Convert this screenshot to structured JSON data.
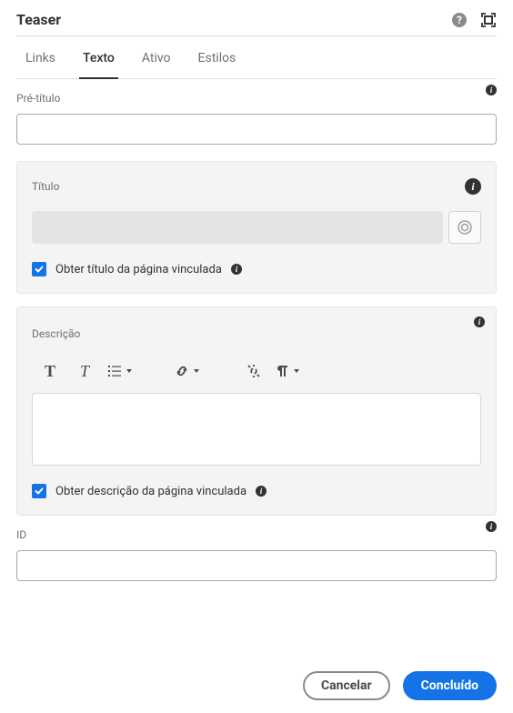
{
  "header": {
    "title": "Teaser"
  },
  "tabs": [
    {
      "label": "Links",
      "active": false
    },
    {
      "label": "Texto",
      "active": true
    },
    {
      "label": "Ativo",
      "active": false
    },
    {
      "label": "Estilos",
      "active": false
    }
  ],
  "fields": {
    "pretitle": {
      "label": "Pré-título",
      "value": ""
    },
    "title": {
      "label": "Título",
      "value": ""
    },
    "title_checkbox": {
      "label": "Obter título da página vinculada",
      "checked": true
    },
    "description": {
      "label": "Descrição"
    },
    "description_checkbox": {
      "label": "Obter descrição da página vinculada",
      "checked": true
    },
    "id": {
      "label": "ID",
      "value": ""
    }
  },
  "buttons": {
    "cancel": "Cancelar",
    "done": "Concluído"
  }
}
